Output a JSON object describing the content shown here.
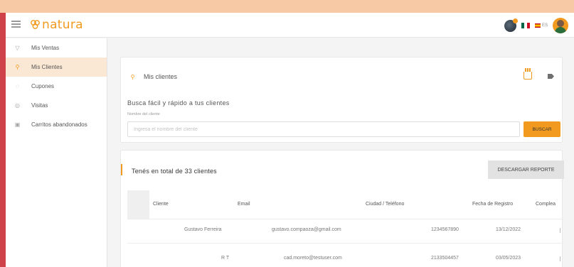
{
  "header": {
    "brand": "natura",
    "language_code": "ES",
    "accent_color": "#f29a1f"
  },
  "sidebar": {
    "items": [
      {
        "label": "Mis Ventas",
        "icon": "shopping-bag-icon"
      },
      {
        "label": "Mis Clientes",
        "icon": "clients-icon",
        "active": true
      },
      {
        "label": "Cupones",
        "icon": "coupon-icon"
      },
      {
        "label": "Visitas",
        "icon": "eye-icon"
      },
      {
        "label": "Carritos abandonados",
        "icon": "cart-icon"
      }
    ]
  },
  "search_card": {
    "title": "Mis clientes",
    "subtitle": "Busca fácil y rápido a tus clientes",
    "field_label": "Nombre del cliente",
    "placeholder": "Ingresa el nombre del cliente",
    "button": "BUSCAR"
  },
  "results": {
    "total_text": "Tenés en total de 33 clientes",
    "download_button": "DESCARGAR REPORTE",
    "columns": [
      "Cliente",
      "Email",
      "Ciudad / Teléfono",
      "Fecha de Registro",
      "Complea"
    ],
    "rows": [
      {
        "client": "Gustavo Ferreira",
        "email": "gustavo.compaoza@gmail.com",
        "phone": "1234567890",
        "date": "13/12/2022"
      },
      {
        "client": "R T",
        "email": "cad.moreto@testuser.com",
        "phone": "2133504457",
        "date": "03/05/2023"
      }
    ]
  }
}
